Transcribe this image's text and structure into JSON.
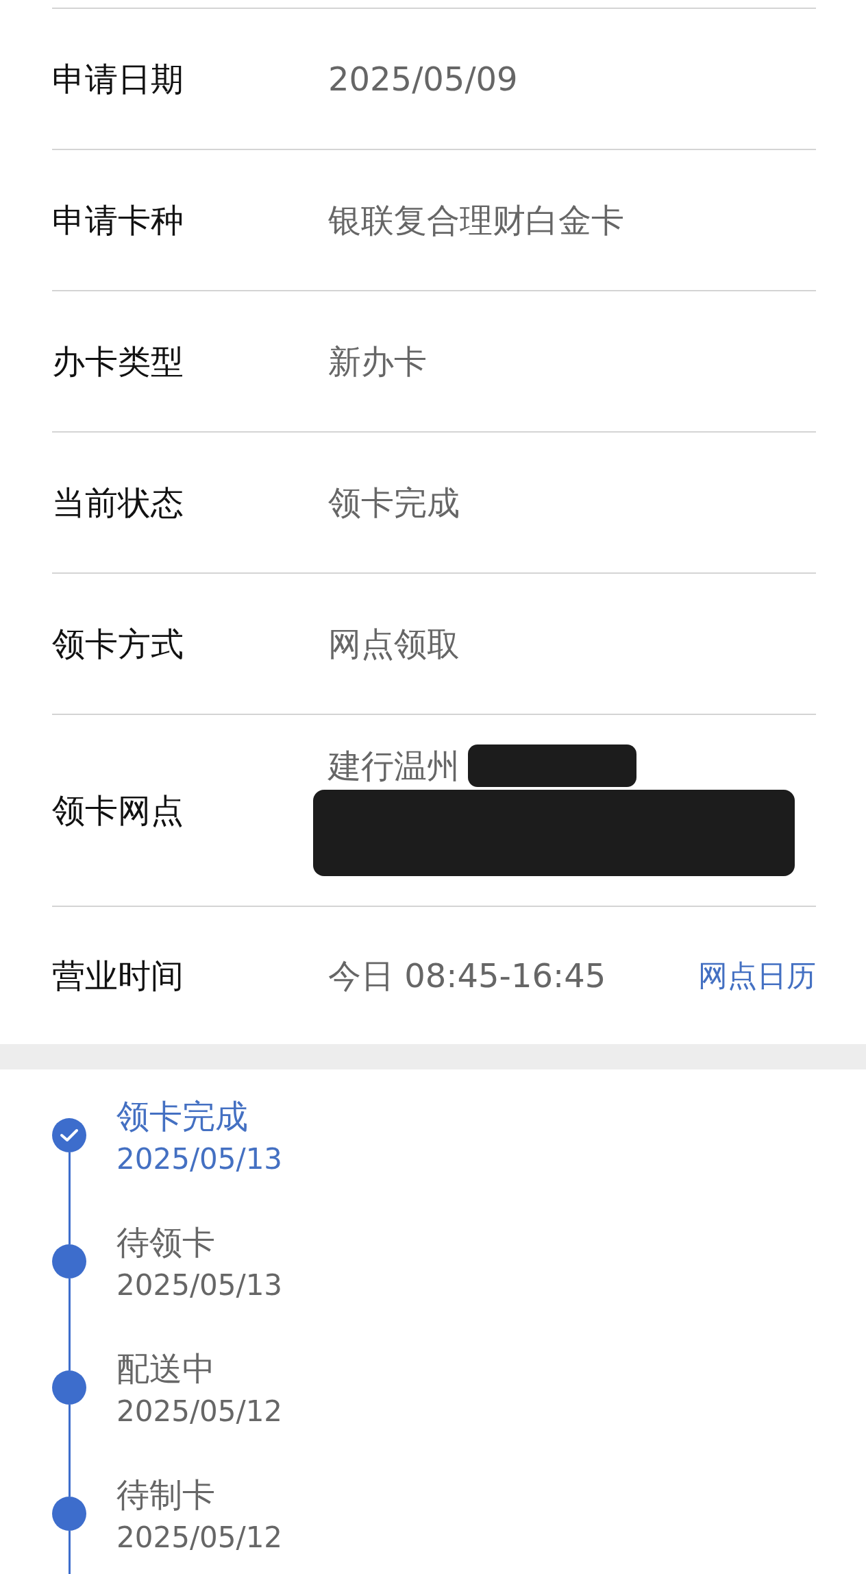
{
  "fields": [
    {
      "label": "申请日期",
      "value": "2025/05/09",
      "redacted": false
    },
    {
      "label": "申请卡种",
      "value": "银联复合理财白金卡",
      "redacted": false
    },
    {
      "label": "办卡类型",
      "value": "新办卡",
      "redacted": false
    },
    {
      "label": "当前状态",
      "value": "领卡完成",
      "redacted": false
    },
    {
      "label": "领卡方式",
      "value": "网点领取",
      "redacted": false
    },
    {
      "label": "领卡网点",
      "value": "建行温州",
      "redacted": true
    },
    {
      "label": "营业时间",
      "value": "今日 08:45-16:45",
      "redacted": false,
      "link": "网点日历"
    }
  ],
  "timeline": [
    {
      "title": "领卡完成",
      "date": "2025/05/13",
      "done": true
    },
    {
      "title": "待领卡",
      "date": "2025/05/13",
      "done": false
    },
    {
      "title": "配送中",
      "date": "2025/05/12",
      "done": false
    },
    {
      "title": "待制卡",
      "date": "2025/05/12",
      "done": false
    }
  ]
}
